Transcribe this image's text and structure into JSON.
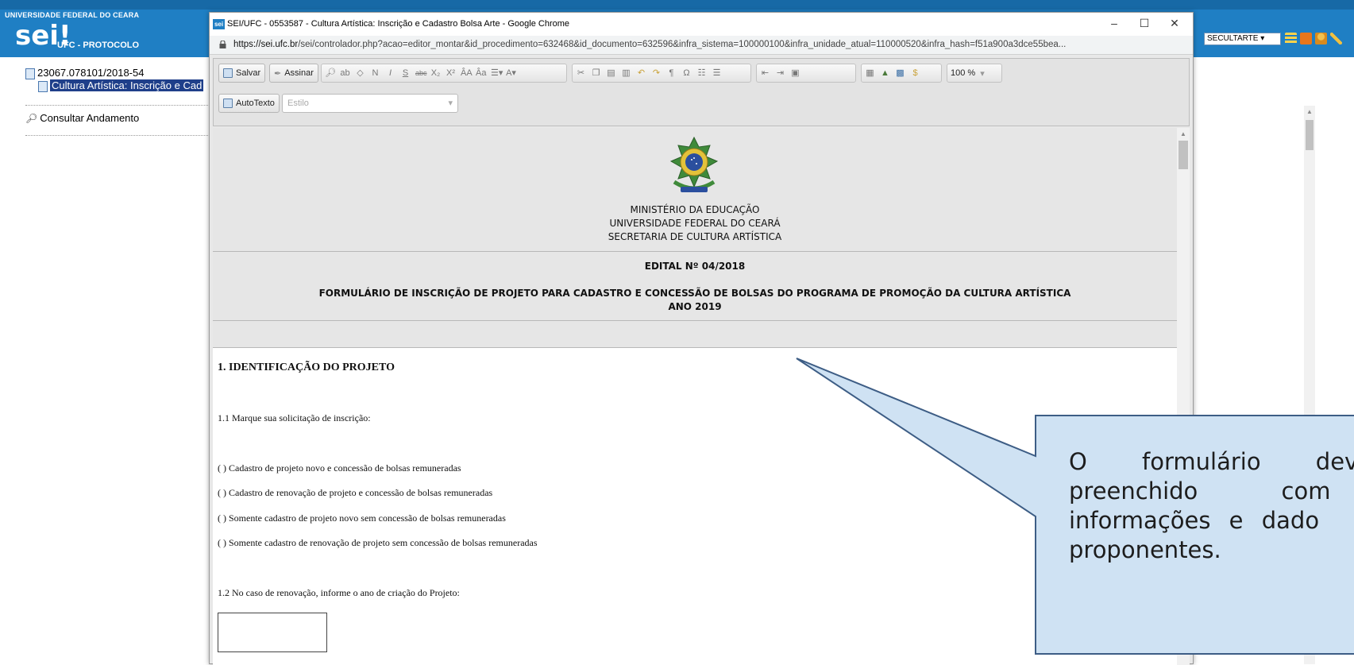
{
  "sei": {
    "university": "UNIVERSIDADE FEDERAL DO CEARA",
    "logo": "sei!",
    "unit": "UFC - PROTOCOLO",
    "unit_select": "SECULTARTE",
    "header_icons": [
      "menu-icon",
      "notes-icon",
      "user-icon",
      "tools-icon"
    ]
  },
  "tree": {
    "process": "23067.078101/2018-54",
    "document": "Cultura Artística: Inscrição e Cad",
    "consult": "Consultar Andamento"
  },
  "popup": {
    "favicon": "sei",
    "title": "SEI/UFC - 0553587 - Cultura Artística: Inscrição e Cadastro Bolsa Arte - Google Chrome",
    "url_host": "https://sei.ufc.br",
    "url_path": "/sei/controlador.php?acao=editor_montar&id_procedimento=632468&id_documento=632596&infra_sistema=100000100&infra_unidade_atual=110000520&infra_hash=f51a900a3dce55bea...",
    "controls": {
      "minimize": "–",
      "maximize": "☐",
      "close": "✕"
    }
  },
  "toolbar": {
    "save_label": "Salvar",
    "sign_label": "Assinar",
    "zoom": "100 %",
    "autotext_label": "AutoTexto",
    "style_placeholder": "Estilo",
    "format_glyphs": [
      "N",
      "I",
      "S",
      "abc",
      "X₂",
      "X²",
      "ÂA",
      "Âa",
      "☰▾",
      "A▾"
    ]
  },
  "document": {
    "header": {
      "ministry": "MINISTÉRIO DA EDUCAÇÃO",
      "university": "UNIVERSIDADE FEDERAL DO CEARÁ",
      "secretariat": "SECRETARIA DE CULTURA ARTÍSTICA",
      "edital": "EDITAL Nº 04/2018",
      "form_title": "FORMULÁRIO DE INSCRIÇÃO DE PROJETO PARA CADASTRO E CONCESSÃO DE BOLSAS DO PROGRAMA DE PROMOÇÃO DA CULTURA ARTÍSTICA",
      "year": "ANO 2019"
    },
    "section_title": "1. IDENTIFICAÇÃO DO PROJETO",
    "q1": "1.1 Marque sua solicitação de inscrição:",
    "options": [
      "(   ) Cadastro de projeto novo e concessão de bolsas remuneradas",
      "(   ) Cadastro de renovação de projeto e concessão de bolsas remuneradas",
      "(   ) Somente cadastro de projeto novo sem concessão de bolsas remuneradas",
      "(   ) Somente cadastro de renovação de projeto sem concessão de bolsas remuneradas"
    ],
    "q2": "1.2 No caso de renovação, informe o ano de criação do Projeto:"
  },
  "callout": {
    "lines": [
      "O formulário deve",
      "preenchido com",
      "informações e dado",
      "proponentes."
    ],
    "fill": "#cfe2f3",
    "stroke": "#3d5d85"
  }
}
